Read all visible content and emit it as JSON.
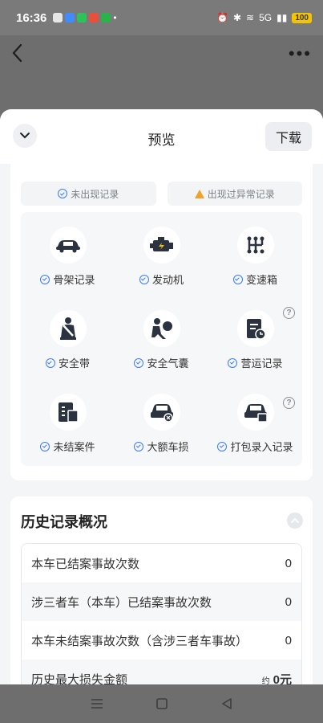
{
  "status": {
    "time": "16:36",
    "network": "5G",
    "battery": "100"
  },
  "sheet": {
    "title": "预览",
    "download_label": "下载"
  },
  "legend": {
    "normal": "未出现记录",
    "abnormal": "出现过异常记录"
  },
  "items": [
    {
      "label": "骨架记录",
      "icon": "car-frame-icon",
      "help": false
    },
    {
      "label": "发动机",
      "icon": "engine-icon",
      "help": false
    },
    {
      "label": "变速箱",
      "icon": "gearbox-icon",
      "help": false
    },
    {
      "label": "安全带",
      "icon": "seatbelt-icon",
      "help": false
    },
    {
      "label": "安全气囊",
      "icon": "airbag-icon",
      "help": false
    },
    {
      "label": "营运记录",
      "icon": "operation-record-icon",
      "help": true
    },
    {
      "label": "未结案件",
      "icon": "pending-case-icon",
      "help": false
    },
    {
      "label": "大额车损",
      "icon": "major-damage-icon",
      "help": false
    },
    {
      "label": "打包录入记录",
      "icon": "bundle-record-icon",
      "help": true
    }
  ],
  "history": {
    "title": "历史记录概况",
    "rows": [
      {
        "label": "本车已结案事故次数",
        "value": "0"
      },
      {
        "label": "涉三者车（本车）已结案事故次数",
        "value": "0"
      },
      {
        "label": "本车未结案事故次数（含涉三者车事故）",
        "value": "0"
      },
      {
        "label": "历史最大损失金额",
        "prefix": "约",
        "value": "0元"
      }
    ]
  },
  "colors": {
    "accent": "#3a7bff",
    "warning": "#f0a22a",
    "icon_dark": "#2b3240"
  }
}
